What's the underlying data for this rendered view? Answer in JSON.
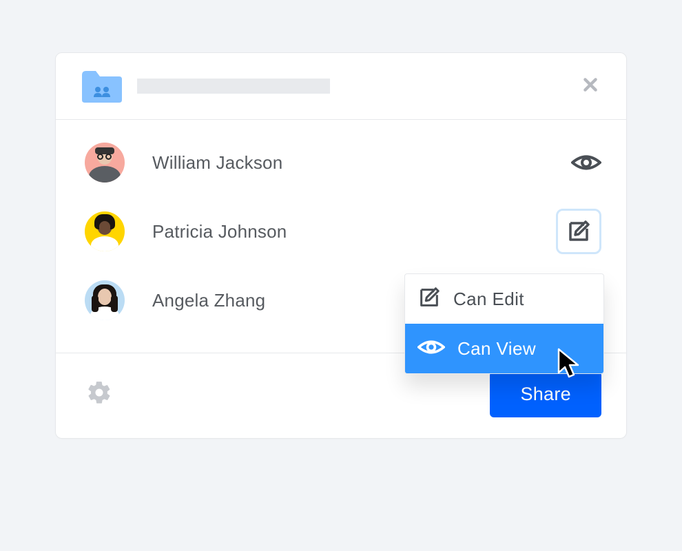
{
  "colors": {
    "accent": "#0061fe",
    "dropdown_selected": "#2f94fe",
    "text": "#575b60"
  },
  "members": [
    {
      "name": "William Jackson",
      "permission": "view",
      "avatar_bg": "#f7a99e"
    },
    {
      "name": "Patricia Johnson",
      "permission": "edit",
      "avatar_bg": "#ffd500",
      "permission_menu_open": true
    },
    {
      "name": "Angela Zhang",
      "permission": "",
      "avatar_bg": "#bbdcf4"
    }
  ],
  "permission_menu": {
    "options": [
      {
        "key": "edit",
        "label": "Can Edit"
      },
      {
        "key": "view",
        "label": "Can View"
      }
    ],
    "selected": "view"
  },
  "footer": {
    "share_label": "Share"
  }
}
